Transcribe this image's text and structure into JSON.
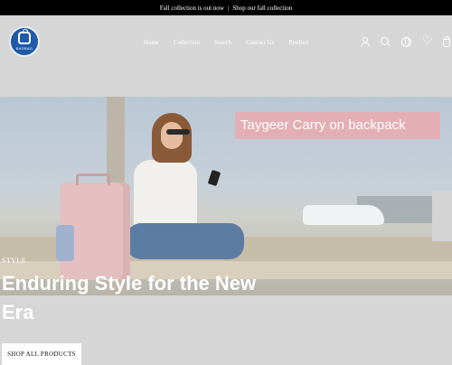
{
  "announcement": {
    "left": "Fall collection is out now",
    "separator": "|",
    "right": "Shop our fall collection"
  },
  "brand": {
    "logo_text": "BAGBAG",
    "accent": "#1f5aa6"
  },
  "nav": {
    "items": [
      {
        "label": "Home"
      },
      {
        "label": "Collection"
      },
      {
        "label": "Search"
      },
      {
        "label": "Contact Us"
      },
      {
        "label": "Product"
      }
    ]
  },
  "header_icons": [
    "user-icon",
    "search-icon",
    "globe-icon",
    "heart-icon",
    "cart-icon"
  ],
  "hero": {
    "banner_text": "Taygeer Carry on backpack",
    "eyebrow": "STYLE",
    "headline": "Enduring Style for the New Era",
    "cta_label": "SHOP ALL PRODUCTS"
  }
}
